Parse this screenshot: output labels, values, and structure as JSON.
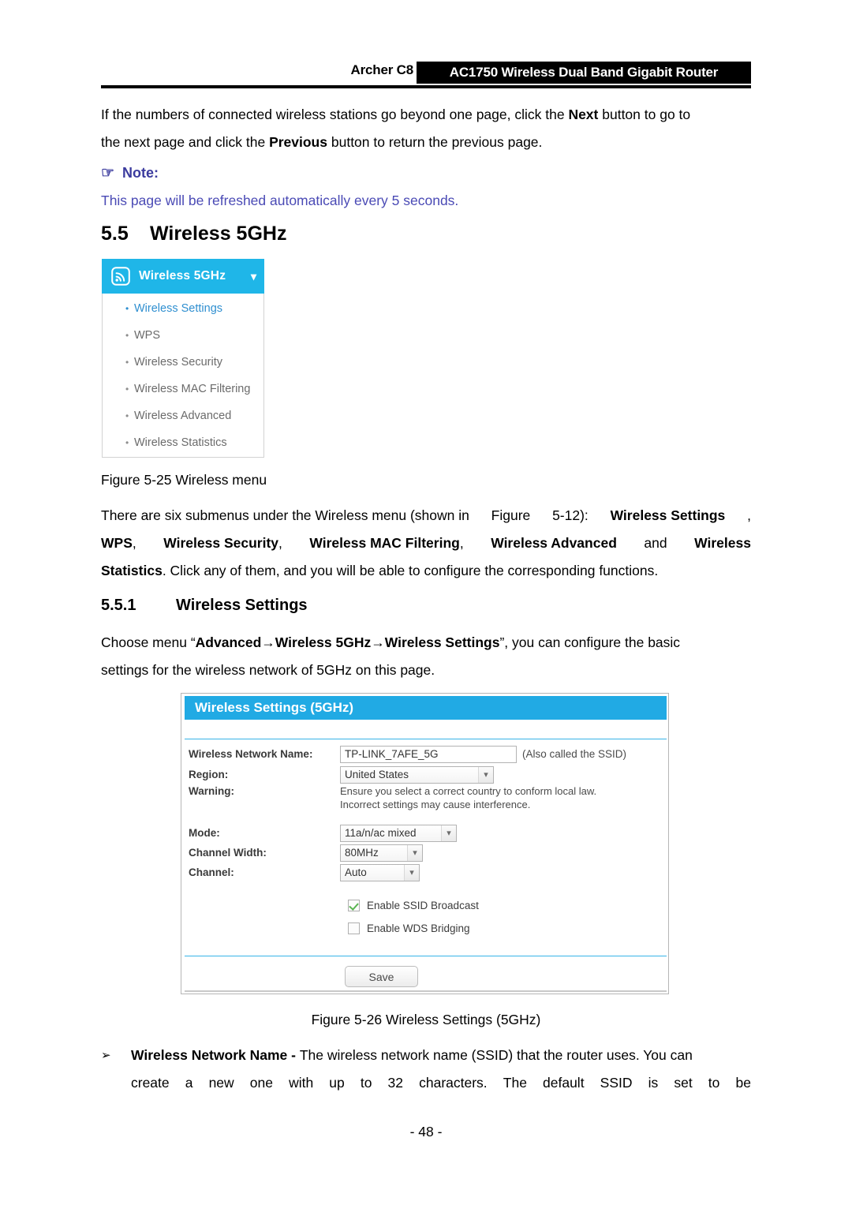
{
  "header": {
    "model": "Archer C8",
    "banner": "AC1750 Wireless Dual Band Gigabit Router"
  },
  "intro": {
    "line1_a": "If the numbers of connected wireless stations go beyond one page, click the ",
    "line1_b": "Next",
    "line1_c": " button to go to",
    "line2_a": "the next page and click the ",
    "line2_b": "Previous",
    "line2_c": " button to return the previous page."
  },
  "note": {
    "icon": "pointing-hand-icon",
    "label": "Note:",
    "text": "This page will be refreshed automatically every 5 seconds."
  },
  "section": {
    "number": "5.5",
    "title": "Wireless 5GHz"
  },
  "wireless_menu": {
    "icon": "wifi-signal-icon",
    "title": "Wireless 5GHz",
    "chevron": "chevron-down-icon",
    "items": [
      {
        "label": "Wireless Settings",
        "active": true
      },
      {
        "label": "WPS",
        "active": false
      },
      {
        "label": "Wireless Security",
        "active": false
      },
      {
        "label": "Wireless MAC Filtering",
        "active": false
      },
      {
        "label": "Wireless Advanced",
        "active": false
      },
      {
        "label": "Wireless Statistics",
        "active": false
      }
    ]
  },
  "figure_25_caption": "Figure 5-25 Wireless menu",
  "submenu_para": {
    "l1_a": "There are six submenus under the Wireless menu (shown in ",
    "l1_b": "Figure",
    "l1_c": " 5-12): ",
    "l1_d": "Wireless Settings",
    "l1_e": ",",
    "l2_a": "WPS",
    "l2_b": ",",
    "l2_c": "Wireless Security",
    "l2_d": ",",
    "l2_e": "Wireless MAC Filtering",
    "l2_f": ",",
    "l2_g": "Wireless Advanced",
    "l2_h": "and",
    "l2_i": "Wireless",
    "l3_a": "Statistics",
    "l3_b": ". Click any of them, and you will be able to configure the corresponding functions."
  },
  "subsection": {
    "number": "5.5.1",
    "title": "Wireless Settings"
  },
  "choose_para": {
    "l1_a": "Choose menu “",
    "l1_b": "Advanced→Wireless 5GHz→Wireless Settings",
    "l1_c": "”, you can configure the basic",
    "l2": "settings for the wireless network of 5GHz on this page."
  },
  "dialog": {
    "title": "Wireless Settings (5GHz)",
    "fields": {
      "ssid_label": "Wireless Network Name:",
      "ssid_value": "TP-LINK_7AFE_5G",
      "ssid_hint": "(Also called the SSID)",
      "region_label": "Region:",
      "region_value": "United States",
      "warning_label": "Warning:",
      "warning_line1": "Ensure you select a correct country to conform local law.",
      "warning_line2": "Incorrect settings may cause interference.",
      "mode_label": "Mode:",
      "mode_value": "11a/n/ac mixed",
      "channel_width_label": "Channel Width:",
      "channel_width_value": "80MHz",
      "channel_label": "Channel:",
      "channel_value": "Auto"
    },
    "checkboxes": [
      {
        "label": "Enable SSID Broadcast",
        "checked": true
      },
      {
        "label": "Enable WDS Bridging",
        "checked": false
      }
    ],
    "save_label": "Save",
    "dropdown_arrow": "chevron-down-icon",
    "accent_color": "#21aae4",
    "check_color": "#5ab552"
  },
  "figure_26_caption": "Figure 5-26 Wireless Settings (5GHz)",
  "bullet_para": {
    "marker": "➢",
    "l1_a": "Wireless Network Name - ",
    "l1_b": "The wireless network name (SSID) that the router uses. You can",
    "l2_words": [
      "create",
      "a",
      "new",
      "one",
      "with",
      "up",
      "to",
      "32",
      "characters.",
      "The",
      "default",
      "SSID",
      "is",
      "set",
      "to",
      "be"
    ]
  },
  "page_number": "- 48 -"
}
